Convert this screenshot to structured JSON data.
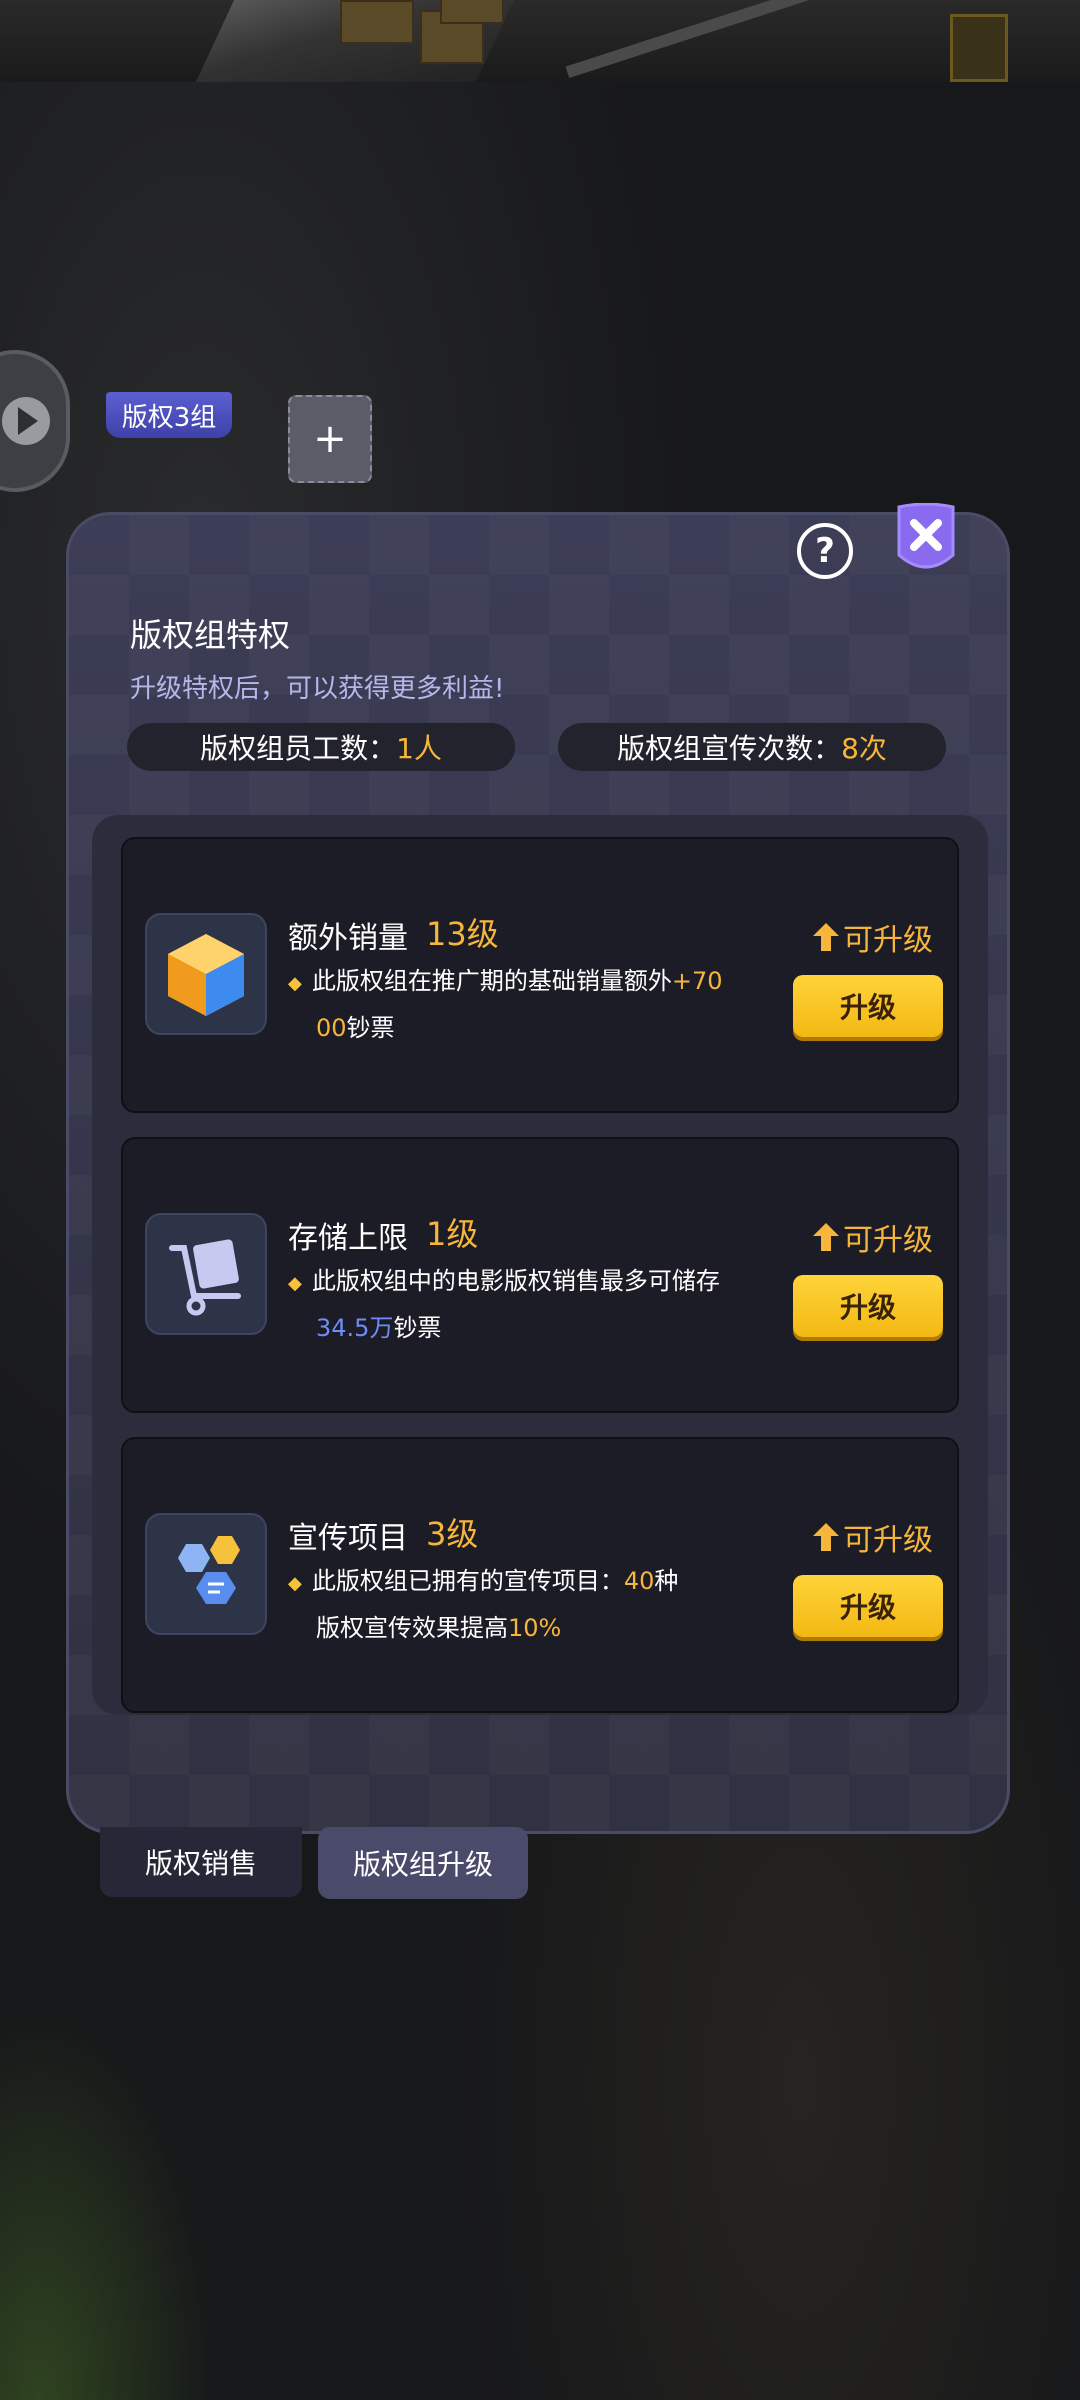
{
  "colors": {
    "accent": "#f6b53b",
    "panel": "#35364b",
    "button": "#ffd43a",
    "link_blue": "#6f8df6"
  },
  "header": {
    "group_tag": "版权3组",
    "add_label": "+"
  },
  "panel": {
    "title": "版权组特权",
    "subtitle": "升级特权后，可以获得更多利益!",
    "stats": [
      {
        "label": "版权组员工数：",
        "value": "1人"
      },
      {
        "label": "版权组宣传次数：",
        "value": "8次"
      }
    ]
  },
  "cards": [
    {
      "icon": "cube-icon",
      "name": "额外销量",
      "level": "13级",
      "desc_line1": "此版权组在推广期的基础销量额外",
      "desc_highlight1": "+70",
      "desc_highlight2": "00",
      "desc_line2": "钞票",
      "status": "可升级",
      "button": "升级"
    },
    {
      "icon": "cart-icon",
      "name": "存储上限",
      "level": "1级",
      "desc_line1": "此版权组中的电影版权销售最多可储存",
      "desc_highlight": "34.5万",
      "desc_line2": "钞票",
      "status": "可升级",
      "button": "升级"
    },
    {
      "icon": "hexagons-icon",
      "name": "宣传项目",
      "level": "3级",
      "desc_line1": "此版权组已拥有的宣传项目：",
      "desc_highlight1": "40",
      "desc_tail1": "种",
      "desc_line2": "版权宣传效果提高",
      "desc_highlight2": "10%",
      "status": "可升级",
      "button": "升级"
    }
  ],
  "tabs": [
    {
      "label": "版权销售",
      "active": false
    },
    {
      "label": "版权组升级",
      "active": true
    }
  ]
}
